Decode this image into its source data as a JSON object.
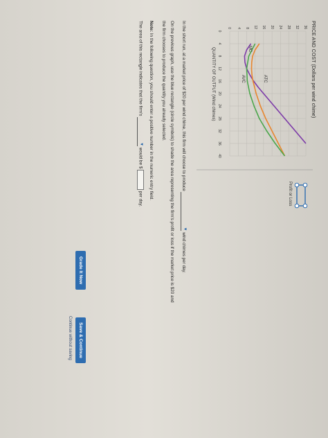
{
  "graph": {
    "y_axis_title": "PRICE AND COST (Dollars per wind chime)",
    "x_axis_title": "QUANTITY OF OUTPUT (Wind chimes)",
    "y_ticks": [
      "36",
      "32",
      "28",
      "24",
      "20",
      "16",
      "12",
      "8",
      "4",
      "0"
    ],
    "x_ticks": [
      "0",
      "4",
      "8",
      "12",
      "16",
      "20",
      "24",
      "28",
      "32",
      "36",
      "40"
    ],
    "curve_labels": {
      "mc": "MC",
      "atc": "ATC",
      "avc": "AVC"
    },
    "tool_label": "Profit or Loss"
  },
  "chart_data": {
    "type": "line",
    "title": "",
    "xlabel": "QUANTITY OF OUTPUT (Wind chimes)",
    "ylabel": "PRICE AND COST (Dollars per wind chime)",
    "xlim": [
      0,
      40
    ],
    "ylim": [
      0,
      36
    ],
    "series": [
      {
        "name": "MC",
        "color": "#7c3aa8",
        "x": [
          4,
          6,
          8,
          10,
          12,
          14,
          16,
          18,
          20,
          22,
          24,
          26,
          28,
          30,
          32,
          34,
          36
        ],
        "y": [
          10,
          8,
          7,
          7.2,
          8,
          9.5,
          11.3,
          13.5,
          16,
          18.5,
          21,
          23.5,
          26,
          28.5,
          31,
          33.5,
          36
        ]
      },
      {
        "name": "ATC",
        "color": "#e8862e",
        "x": [
          4,
          6,
          8,
          10,
          12,
          14,
          16,
          20,
          24,
          28,
          32,
          36,
          40
        ],
        "y": [
          14,
          12,
          10.8,
          10.4,
          10.3,
          10.5,
          11,
          12.5,
          14.5,
          17,
          20,
          23,
          26
        ]
      },
      {
        "name": "AVC",
        "color": "#4ca64c",
        "x": [
          4,
          8,
          12,
          16,
          20,
          24,
          28,
          32,
          36,
          40
        ],
        "y": [
          12,
          9,
          8,
          8.3,
          9.5,
          11.5,
          14,
          17.5,
          21.5,
          26
        ]
      }
    ],
    "grid": true
  },
  "colors": {
    "button": "#2e6db0",
    "atc": "#e8862e",
    "mc": "#7c3aa8",
    "avc": "#4ca64c",
    "tool": "#2e6db0"
  },
  "question": {
    "line1_pre": "In the short run, at a market price of $20 per wind chime, this firm will choose to produce",
    "line1_post": "wind chimes per day.",
    "line2": "On the previous graph, use the blue rectangle (circle symbols) to shade the area representing the firm's profit or loss if the market price is $20 and",
    "line3": "the firm chooses to produce the quantity you already selected.",
    "note_label": "Note:",
    "note_text": "In the following question, you should enter a positive number in the numeric entry field.",
    "line5_pre": "The area of this rectangle indicates that the firm's",
    "line5_mid": "would be $",
    "line5_post": "per day."
  },
  "buttons": {
    "grade": "Grade It Now",
    "save": "Save & Continue",
    "continue_link": "Continue without saving"
  },
  "icons": {
    "tool": "rectangle-circle-icon"
  }
}
